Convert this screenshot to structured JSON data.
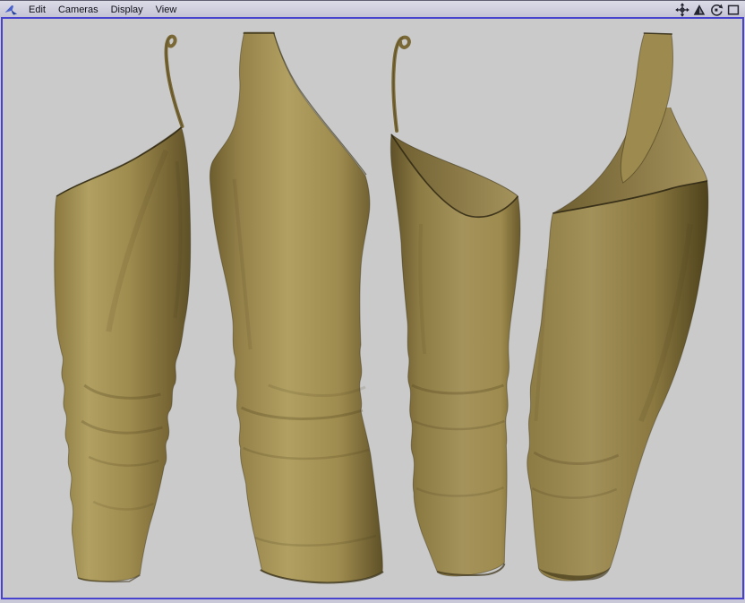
{
  "menubar": {
    "items": [
      {
        "label": "Edit"
      },
      {
        "label": "Cameras"
      },
      {
        "label": "Display"
      },
      {
        "label": "View"
      }
    ],
    "right_icons": [
      "pan-move-icon",
      "triangle-icon",
      "rotate-view-icon",
      "maximize-square-icon"
    ]
  },
  "colors": {
    "menubar_bg": "#c8c8d8",
    "panel_border": "#4743cf",
    "viewport_bg": "#cacaca",
    "cloth_base": "#9e8b4e",
    "cloth_highlight": "#b1a061",
    "cloth_shadow": "#5f5128",
    "cloth_dark_edge": "#332b12",
    "cloth_interior": "#8a7840"
  },
  "viewport": {
    "views": [
      {
        "name": "garment-side-view"
      },
      {
        "name": "garment-front-view"
      },
      {
        "name": "garment-back-quarter-view"
      },
      {
        "name": "garment-back-view"
      }
    ]
  }
}
